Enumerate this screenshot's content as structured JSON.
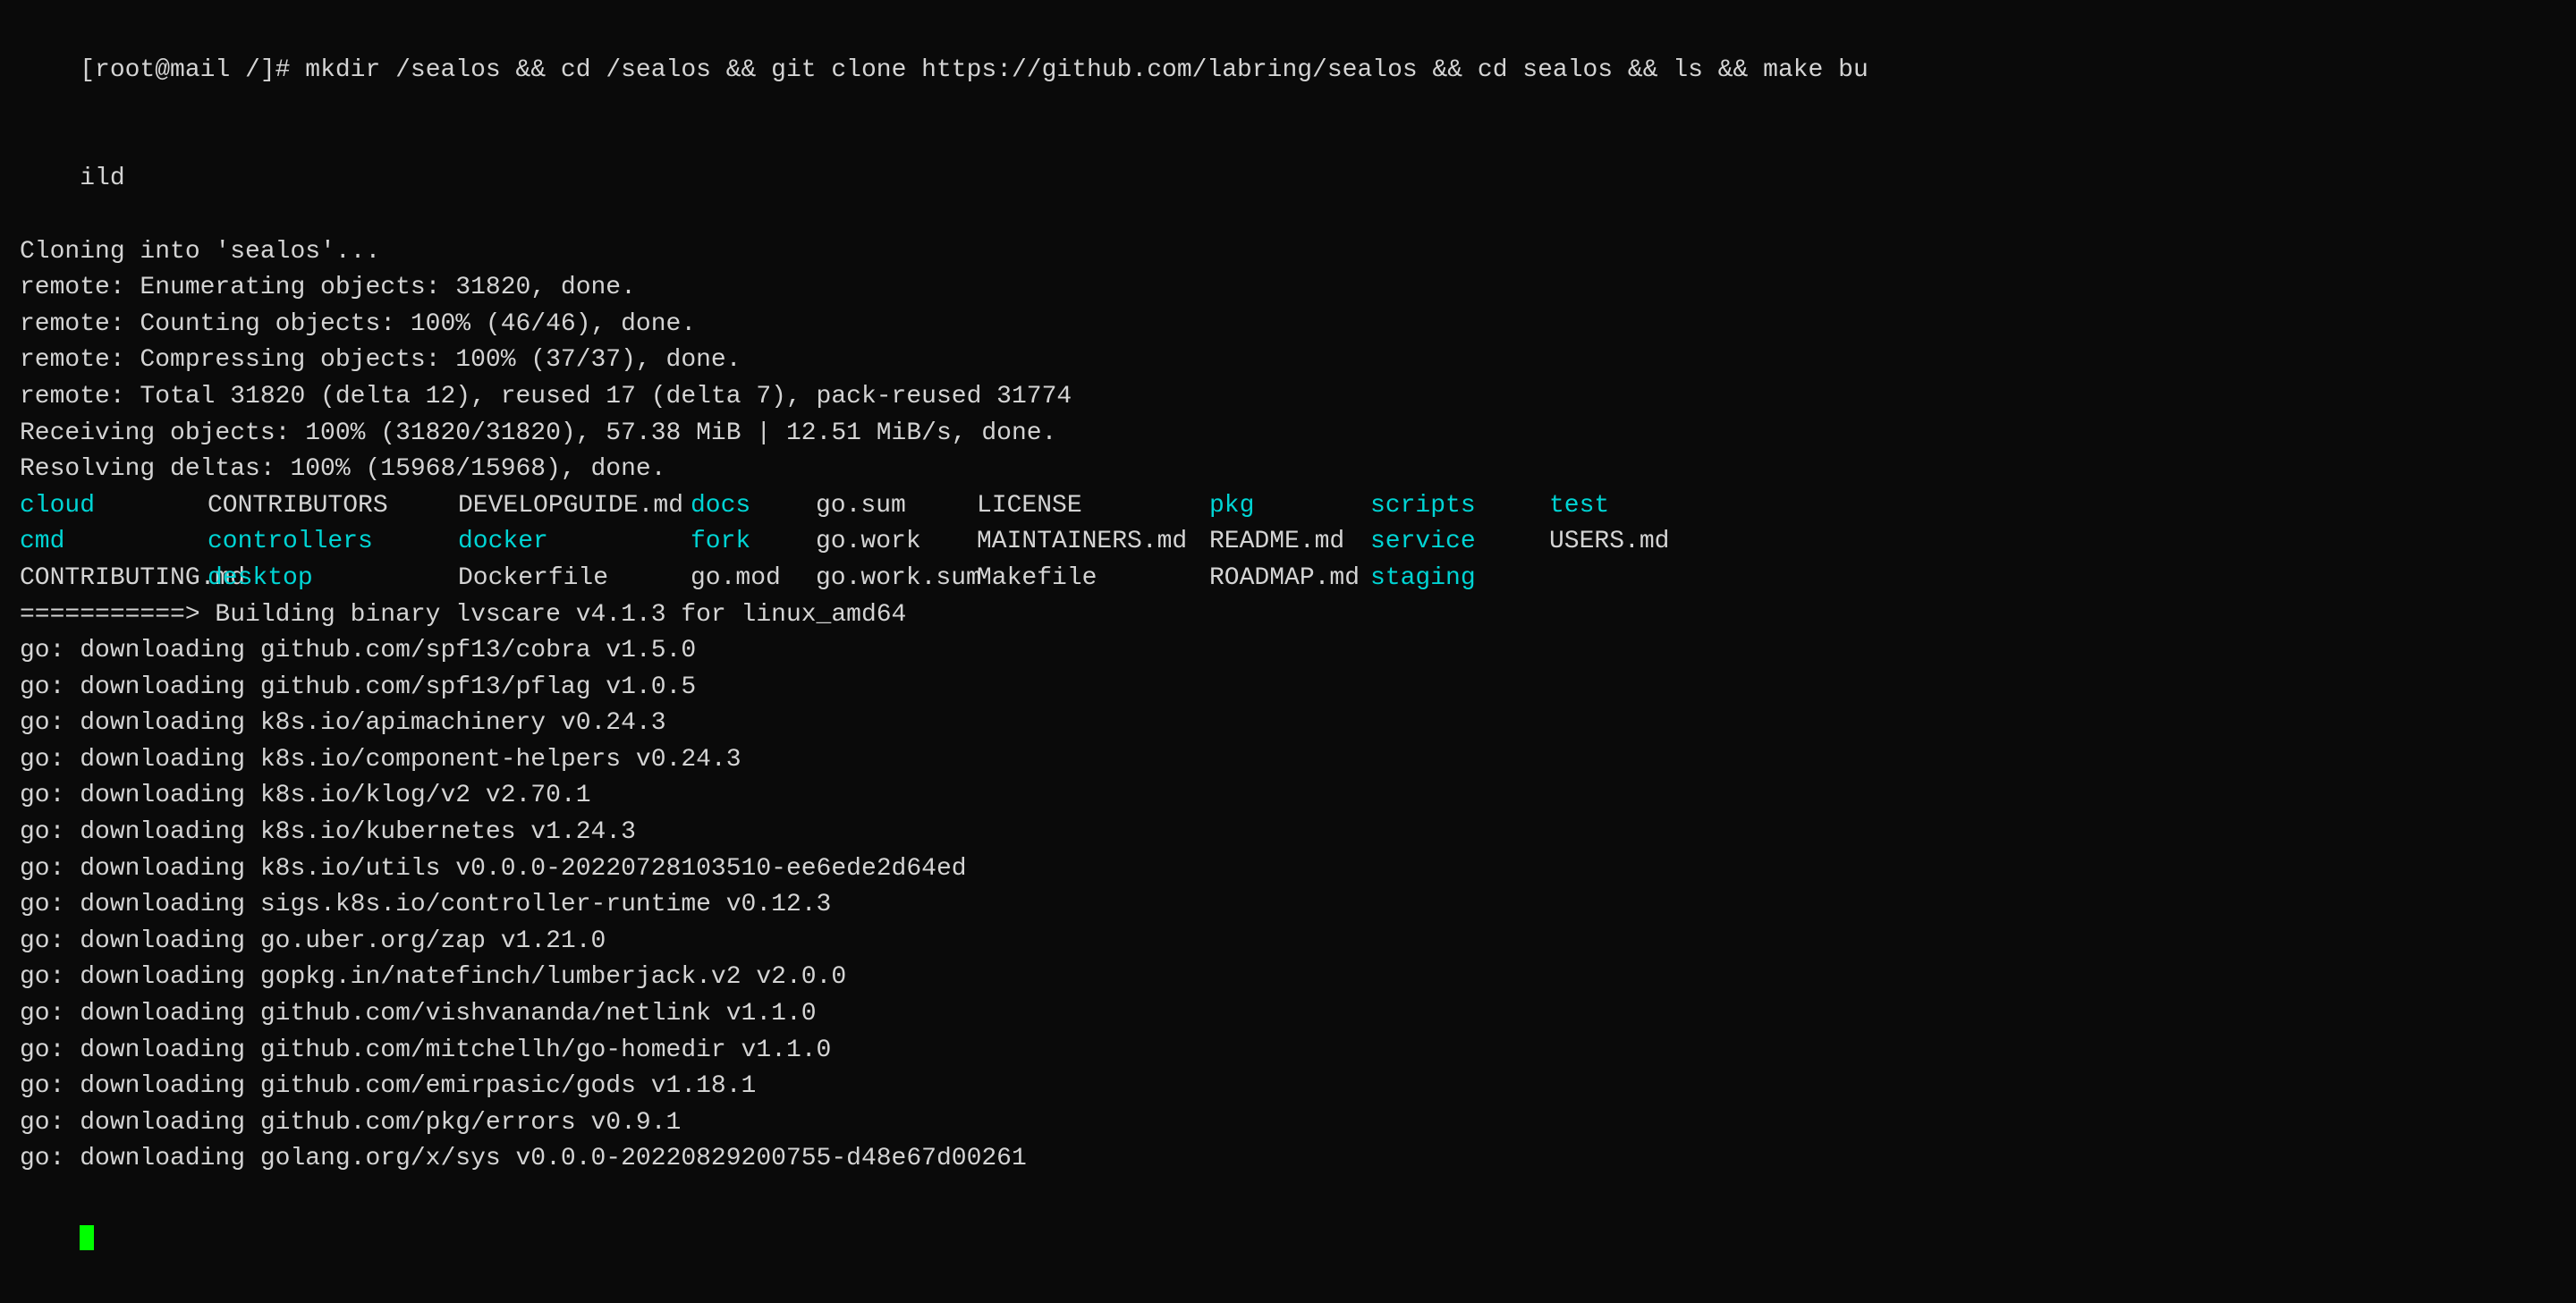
{
  "terminal": {
    "prompt": "[root@mail /]#",
    "command": " mkdir /sealos && cd /sealos && git clone https://github.com/labring/sealos && cd sealos && ls && make bu",
    "command_cont": "ild",
    "lines": [
      {
        "text": "Cloning into 'sealos'...",
        "color": "white"
      },
      {
        "text": "remote: Enumerating objects: 31820, done.",
        "color": "white"
      },
      {
        "text": "remote: Counting objects: 100% (46/46), done.",
        "color": "white"
      },
      {
        "text": "remote: Compressing objects: 100% (37/37), done.",
        "color": "white"
      },
      {
        "text": "remote: Total 31820 (delta 12), reused 17 (delta 7), pack-reused 31774",
        "color": "white"
      },
      {
        "text": "Receiving objects: 100% (31820/31820), 57.38 MiB | 12.51 MiB/s, done.",
        "color": "white"
      },
      {
        "text": "Resolving deltas: 100% (15968/15968), done.",
        "color": "white"
      }
    ],
    "file_listing": {
      "row1": [
        {
          "text": "cloud",
          "color": "cyan"
        },
        {
          "text": "CONTRIBUTORS",
          "color": "white"
        },
        {
          "text": "DEVELOPGUIDE.md",
          "color": "white"
        },
        {
          "text": "docs",
          "color": "cyan"
        },
        {
          "text": "go.sum",
          "color": "white"
        },
        {
          "text": "LICENSE",
          "color": "white"
        },
        {
          "text": "pkg",
          "color": "cyan"
        },
        {
          "text": "scripts",
          "color": "cyan"
        },
        {
          "text": "test",
          "color": "cyan"
        }
      ],
      "row2": [
        {
          "text": "cmd",
          "color": "cyan"
        },
        {
          "text": "controllers",
          "color": "cyan"
        },
        {
          "text": "docker",
          "color": "cyan"
        },
        {
          "text": "fork",
          "color": "cyan"
        },
        {
          "text": "go.work",
          "color": "white"
        },
        {
          "text": "MAINTAINERS.md",
          "color": "white"
        },
        {
          "text": "README.md",
          "color": "white"
        },
        {
          "text": "service",
          "color": "cyan"
        },
        {
          "text": "USERS.md",
          "color": "white"
        }
      ],
      "row3": [
        {
          "text": "CONTRIBUTING.md",
          "color": "white"
        },
        {
          "text": "desktop",
          "color": "cyan"
        },
        {
          "text": "Dockerfile",
          "color": "white"
        },
        {
          "text": "go.mod",
          "color": "white"
        },
        {
          "text": "go.work.sum",
          "color": "white"
        },
        {
          "text": "Makefile",
          "color": "white"
        },
        {
          "text": "ROADMAP.md",
          "color": "white"
        },
        {
          "text": "staging",
          "color": "cyan"
        },
        {
          "text": "",
          "color": "white"
        }
      ]
    },
    "build_line": "===========> Building binary lvscare v4.1.3 for linux_amd64",
    "go_downloads": [
      "go: downloading github.com/spf13/cobra v1.5.0",
      "go: downloading github.com/spf13/pflag v1.0.5",
      "go: downloading k8s.io/apimachinery v0.24.3",
      "go: downloading k8s.io/component-helpers v0.24.3",
      "go: downloading k8s.io/klog/v2 v2.70.1",
      "go: downloading k8s.io/kubernetes v1.24.3",
      "go: downloading k8s.io/utils v0.0.0-20220728103510-ee6ede2d64ed",
      "go: downloading sigs.k8s.io/controller-runtime v0.12.3",
      "go: downloading go.uber.org/zap v1.21.0",
      "go: downloading gopkg.in/natefinch/lumberjack.v2 v2.0.0",
      "go: downloading github.com/vishvananda/netlink v1.1.0",
      "go: downloading github.com/mitchellh/go-homedir v1.1.0",
      "go: downloading github.com/emirpasic/gods v1.18.1",
      "go: downloading github.com/pkg/errors v0.9.1",
      "go: downloading golang.org/x/sys v0.0.0-20220829200755-d48e67d00261"
    ]
  }
}
